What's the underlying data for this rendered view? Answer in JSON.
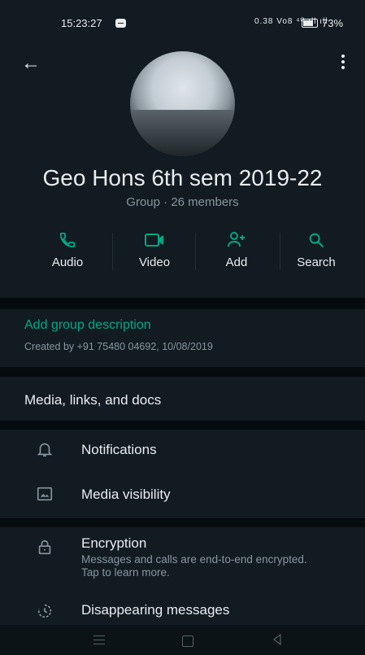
{
  "status_bar": {
    "time": "15:23:27",
    "network": "0.38 Vo8 ⁴ᴳ ıll ıll",
    "battery": "73%"
  },
  "group": {
    "name": "Geo Hons 6th sem 2019-22",
    "subtitle": "Group · 26 members"
  },
  "actions": [
    {
      "label": "Audio",
      "icon": "phone-icon"
    },
    {
      "label": "Video",
      "icon": "video-icon"
    },
    {
      "label": "Add",
      "icon": "add-person-icon"
    },
    {
      "label": "Search",
      "icon": "search-icon"
    }
  ],
  "description": {
    "add_label": "Add group description",
    "created": "Created by +91 75480 04692, 10/08/2019"
  },
  "media": {
    "label": "Media, links, and docs"
  },
  "settings": [
    {
      "label": "Notifications",
      "icon": "bell-icon"
    },
    {
      "label": "Media visibility",
      "icon": "image-icon"
    },
    {
      "label": "Encryption",
      "icon": "lock-icon",
      "subtitle": "Messages and calls are end-to-end encrypted. Tap to learn more."
    },
    {
      "label": "Disappearing messages",
      "icon": "timer-icon"
    }
  ],
  "colors": {
    "accent": "#00a884",
    "background": "#111b21",
    "text": "#e9edef",
    "muted": "#8696a0"
  }
}
